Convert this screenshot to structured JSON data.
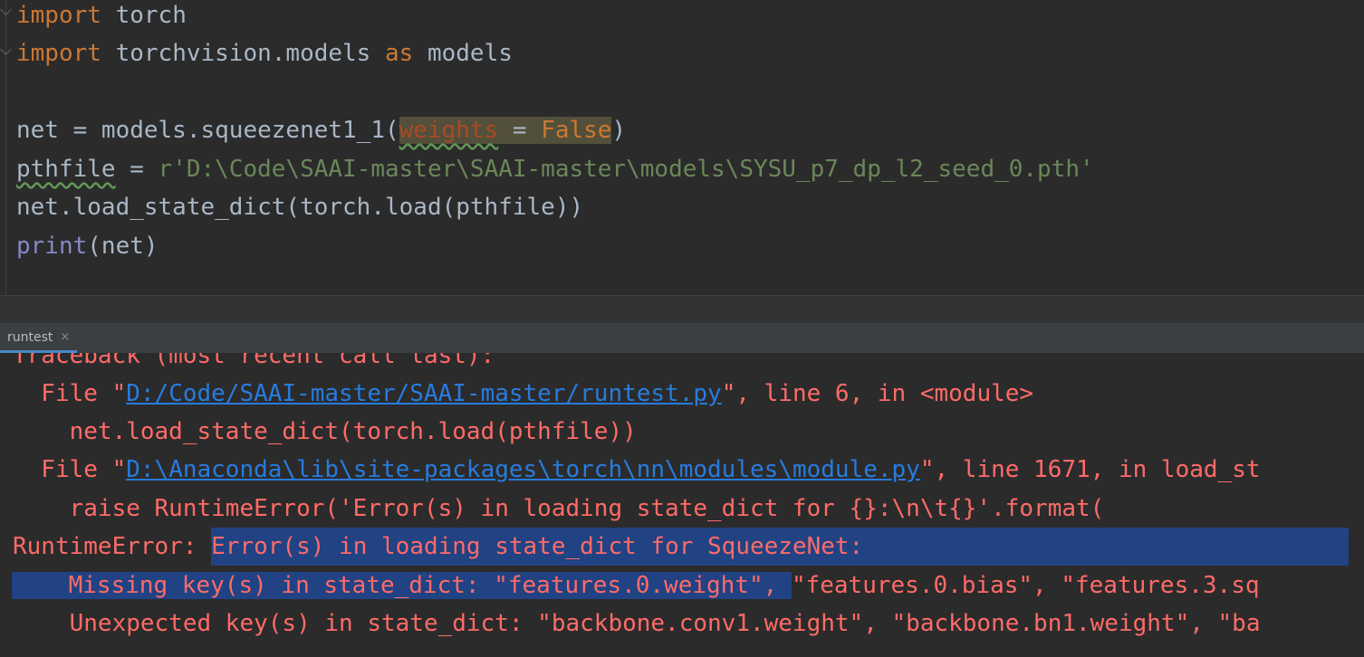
{
  "editor": {
    "line1": {
      "kw": "import",
      "rest": " torch"
    },
    "line2": {
      "kw": "import",
      "mid": " torchvision.models ",
      "kw2": "as",
      "rest": " models"
    },
    "line4": {
      "pre": "net = models.squeezenet1_1(",
      "param": "weights",
      "eq": " = ",
      "val": "False",
      "post": ")"
    },
    "line5": {
      "var": "pthfile",
      "eq": " = ",
      "str": "r'D:\\Code\\SAAI-master\\SAAI-master\\models\\SYSU_p7_dp_l2_seed_0.pth'"
    },
    "line6": {
      "text": "net.load_state_dict(torch.load(pthfile))"
    },
    "line7": {
      "fn": "print",
      "rest": "(net)"
    }
  },
  "run_tab": {
    "label": "runtest",
    "close": "×"
  },
  "console": {
    "l0": "Traceback (most recent call last):",
    "l1": {
      "pre": "  File \"",
      "link": "D:/Code/SAAI-master/SAAI-master/runtest.py",
      "post": "\", line 6, in <module>"
    },
    "l2": "    net.load_state_dict(torch.load(pthfile))",
    "l3": {
      "pre": "  File \"",
      "link": "D:\\Anaconda\\lib\\site-packages\\torch\\nn\\modules\\module.py",
      "post": "\", line 1671, in load_st"
    },
    "l4": "    raise RuntimeError('Error(s) in loading state_dict for {}:\\n\\t{}'.format(",
    "l5": {
      "pre": "RuntimeError: ",
      "sel": "Error(s) in loading state_dict for SqueezeNet:"
    },
    "l6": {
      "sel": "    Missing key(s) in state_dict: \"features.0.weight\", ",
      "post": "\"features.0.bias\", \"features.3.sq"
    },
    "l7": "    Unexpected key(s) in state_dict: \"backbone.conv1.weight\", \"backbone.bn1.weight\", \"ba"
  }
}
